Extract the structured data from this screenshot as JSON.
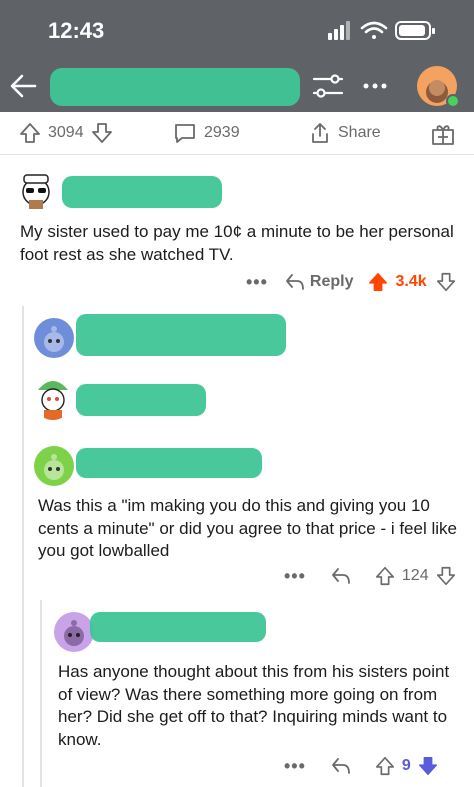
{
  "status_bar": {
    "time": "12:43"
  },
  "post_actions": {
    "upvotes": "3094",
    "comments": "2939",
    "share_label": "Share"
  },
  "comment1": {
    "text": "My sister used to pay me 10¢ a minute to be her personal foot rest as she watched TV.",
    "reply_label": "Reply",
    "score": "3.4k"
  },
  "comment4": {
    "text": "Was this a \"im making you do this and giving you 10 cents a minute\" or did you agree to that price - i feel like you got lowballed",
    "score": "124"
  },
  "comment5": {
    "text": "Has anyone thought about this from his sisters point of view? Was there something more going on from her? Did she get off to that? Inquiring minds want to know.",
    "score": "9"
  },
  "colors": {
    "upvote_active": "#ff4500",
    "downvote_active": "#5a5cdf",
    "redaction": "#3ec596"
  }
}
